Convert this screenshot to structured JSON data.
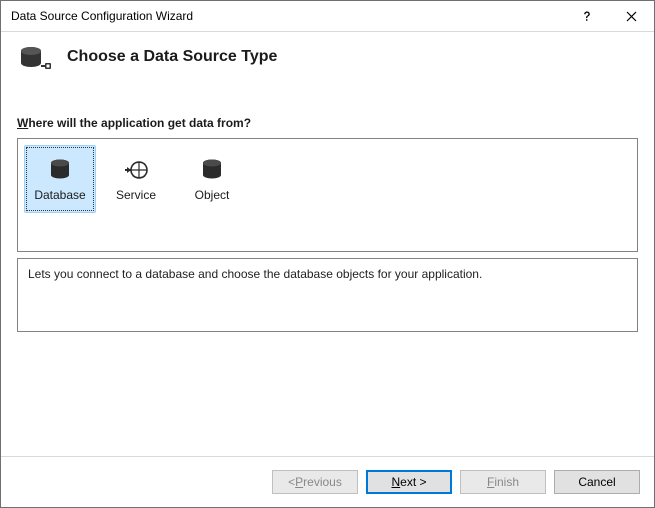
{
  "window": {
    "title": "Data Source Configuration Wizard"
  },
  "header": {
    "title": "Choose a Data Source Type"
  },
  "prompt": {
    "prefix_underlined": "W",
    "rest": "here will the application get data from?"
  },
  "options": [
    {
      "id": "database",
      "label": "Database",
      "icon": "database-icon",
      "selected": true
    },
    {
      "id": "service",
      "label": "Service",
      "icon": "service-icon",
      "selected": false
    },
    {
      "id": "object",
      "label": "Object",
      "icon": "object-icon",
      "selected": false
    }
  ],
  "description": "Lets you connect to a database and choose the database objects for your application.",
  "buttons": {
    "previous": {
      "prefix": "< ",
      "akey": "P",
      "suffix": "revious",
      "enabled": false
    },
    "next": {
      "prefix": "",
      "akey": "N",
      "suffix": "ext >",
      "enabled": true,
      "default": true
    },
    "finish": {
      "prefix": "",
      "akey": "F",
      "suffix": "inish",
      "enabled": false
    },
    "cancel": {
      "label": "Cancel",
      "enabled": true
    }
  }
}
